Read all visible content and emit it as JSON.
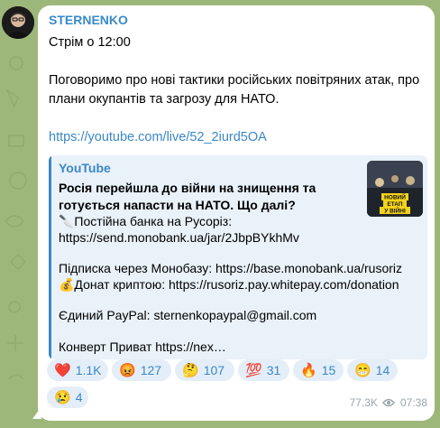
{
  "channel": {
    "name": "STERNENKO"
  },
  "message": {
    "line1": "Стрім о 12:00",
    "line2": "Поговоримо про нові тактики російських повітряних атак, про плани окупантів та загрозу для НАТО.",
    "link": "https://youtube.com/live/52_2iurd5OA"
  },
  "preview": {
    "site": "YouTube",
    "title": "Росія перейшла до війни на знищення та готується напасти на НАТО. Що далі?",
    "desc_line1": "🔪Постійна банка на Русоріз:",
    "desc_line2": "https://send.monobank.ua/jar/2JbpBYkhMv",
    "desc_line3": "Підписка через Монобазу: https://base.monobank.ua/rusoriz",
    "desc_line4": "💰Донат криптою: https://rusoriz.pay.whitepay.com/donation",
    "desc_line5": "Єдиний PayPal: sternenkopaypal@gmail.com",
    "desc_line6": "Конверт Приват https://nex…",
    "thumb_text": [
      "НОВИЙ",
      "ЕТАП",
      "У ВІЙНІ"
    ]
  },
  "reactions": [
    {
      "emoji": "❤️",
      "count": "1.1K"
    },
    {
      "emoji": "😡",
      "count": "127"
    },
    {
      "emoji": "🤔",
      "count": "107"
    },
    {
      "emoji": "💯",
      "count": "31"
    },
    {
      "emoji": "🔥",
      "count": "15"
    },
    {
      "emoji": "😁",
      "count": "14"
    },
    {
      "emoji": "😢",
      "count": "4"
    }
  ],
  "meta": {
    "views": "77.3K",
    "time": "07:38",
    "views_icon": "eye-icon"
  },
  "colors": {
    "accent": "#3b87c7",
    "background": "#9db77a",
    "bubble": "#ffffff",
    "preview_bg": "#e9f1f9"
  }
}
